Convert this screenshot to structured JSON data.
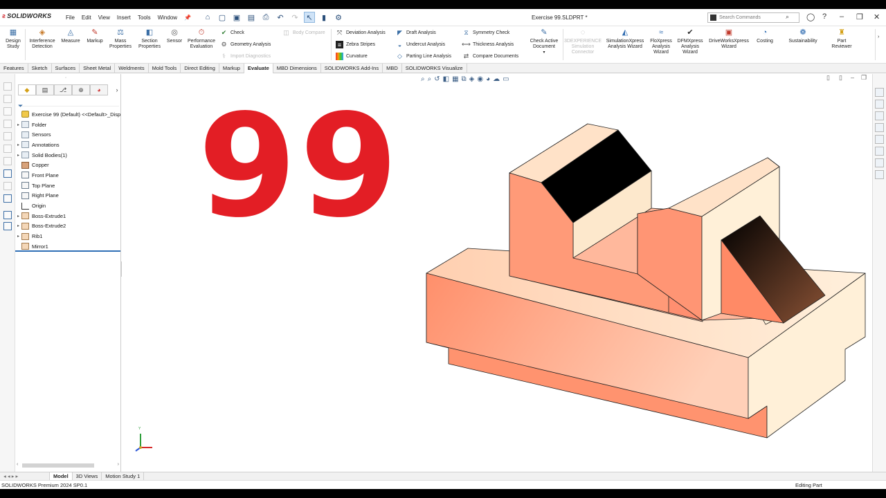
{
  "app": {
    "brand": "SOLIDWORKS",
    "document_title": "Exercise 99.SLDPRT *"
  },
  "menu": [
    "File",
    "Edit",
    "View",
    "Insert",
    "Tools",
    "Window"
  ],
  "search": {
    "placeholder": "Search Commands"
  },
  "ribbon": {
    "big_buttons": [
      {
        "label": "Design\nStudy",
        "icon": "design-study-icon"
      },
      {
        "label": "Interference\nDetection",
        "icon": "interference-icon"
      },
      {
        "label": "Measure",
        "icon": "measure-icon"
      },
      {
        "label": "Markup",
        "icon": "markup-icon"
      },
      {
        "label": "Mass\nProperties",
        "icon": "mass-properties-icon"
      },
      {
        "label": "Section\nProperties",
        "icon": "section-properties-icon"
      },
      {
        "label": "Sensor",
        "icon": "sensor-icon"
      },
      {
        "label": "Performance\nEvaluation",
        "icon": "performance-icon"
      }
    ],
    "small_col1": [
      "Check",
      "Geometry Analysis",
      "Import Diagnostics"
    ],
    "body_compare": "Body Compare",
    "small_col2": [
      "Deviation Analysis",
      "Zebra Stripes",
      "Curvature"
    ],
    "small_col3": [
      "Draft Analysis",
      "Undercut Analysis",
      "Parting Line Analysis"
    ],
    "small_col4": [
      "Symmetry Check",
      "Thickness Analysis",
      "Compare Documents"
    ],
    "check_active": "Check Active\nDocument",
    "right_buttons": [
      {
        "label": "3DEXPERIENCE\nSimulation\nConnector",
        "disabled": true
      },
      {
        "label": "SimulationXpress\nAnalysis Wizard",
        "disabled": false
      },
      {
        "label": "FloXpress\nAnalysis\nWizard",
        "disabled": false
      },
      {
        "label": "DFMXpress\nAnalysis\nWizard",
        "disabled": false
      },
      {
        "label": "DriveWorksXpress\nWizard",
        "disabled": false
      },
      {
        "label": "Costing",
        "disabled": false
      },
      {
        "label": "Sustainability",
        "disabled": false
      },
      {
        "label": "Part\nReviewer",
        "disabled": false
      }
    ]
  },
  "tabs": [
    "Features",
    "Sketch",
    "Surfaces",
    "Sheet Metal",
    "Weldments",
    "Mold Tools",
    "Direct Editing",
    "Markup",
    "Evaluate",
    "MBD Dimensions",
    "SOLIDWORKS Add-Ins",
    "MBD",
    "SOLIDWORKS Visualize"
  ],
  "active_tab": "Evaluate",
  "tree": {
    "root": "Exercise 99 (Default) <<Default>_Disp",
    "items": [
      {
        "label": "Folder",
        "expand": true,
        "kind": "folder"
      },
      {
        "label": "Sensors",
        "expand": false,
        "kind": "folder"
      },
      {
        "label": "Annotations",
        "expand": true,
        "kind": "folder"
      },
      {
        "label": "Solid Bodies(1)",
        "expand": true,
        "kind": "folder"
      },
      {
        "label": "Copper",
        "expand": false,
        "kind": "mat"
      },
      {
        "label": "Front Plane",
        "expand": false,
        "kind": "plane"
      },
      {
        "label": "Top Plane",
        "expand": false,
        "kind": "plane"
      },
      {
        "label": "Right Plane",
        "expand": false,
        "kind": "plane"
      },
      {
        "label": "Origin",
        "expand": false,
        "kind": "orig"
      },
      {
        "label": "Boss-Extrude1",
        "expand": true,
        "kind": "feat"
      },
      {
        "label": "Boss-Extrude2",
        "expand": true,
        "kind": "feat"
      },
      {
        "label": "Rib1",
        "expand": true,
        "kind": "feat"
      },
      {
        "label": "Mirror1",
        "expand": false,
        "kind": "feat"
      }
    ]
  },
  "viewport": {
    "overlay_number": "99",
    "overlay_color": "#e31e25",
    "triad_y": "Y"
  },
  "bottom_tabs": [
    "Model",
    "3D Views",
    "Motion Study 1"
  ],
  "active_bottom_tab": "Model",
  "status": {
    "left": "SOLIDWORKS Premium 2024 SP0.1",
    "right": "Editing Part"
  }
}
